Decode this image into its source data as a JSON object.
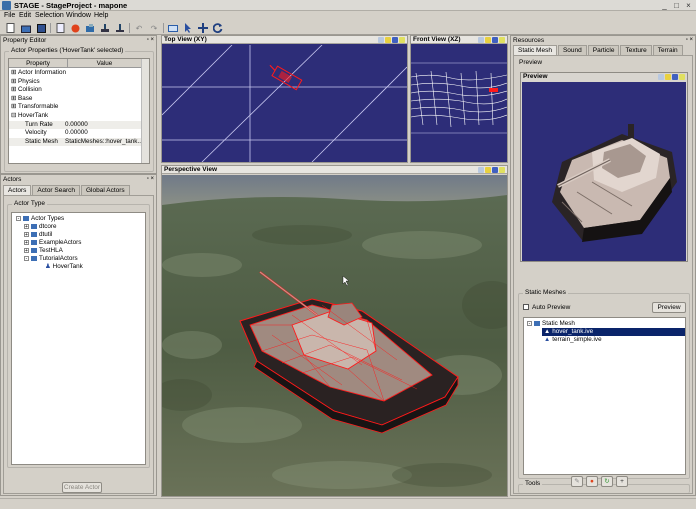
{
  "window": {
    "title": "STAGE - StageProject - mapone"
  },
  "menu": [
    "File",
    "Edit",
    "Selection",
    "Window",
    "Help"
  ],
  "property_editor": {
    "title": "Property Editor",
    "group_label": "Actor Properties ('HoverTank' selected)",
    "columns": [
      "Property",
      "Value"
    ],
    "rows": [
      {
        "name": "Actor Information",
        "value": "",
        "type": "group"
      },
      {
        "name": "Physics",
        "value": "",
        "type": "group"
      },
      {
        "name": "Collision",
        "value": "",
        "type": "group"
      },
      {
        "name": "Base",
        "value": "",
        "type": "group"
      },
      {
        "name": "Transformable",
        "value": "",
        "type": "group"
      },
      {
        "name": "HoverTank",
        "value": "",
        "type": "open"
      },
      {
        "name": "Turn Rate",
        "value": "0.00000",
        "type": "prop"
      },
      {
        "name": "Velocity",
        "value": "0.00000",
        "type": "prop"
      },
      {
        "name": "Static Mesh",
        "value": "StaticMeshes::hover_tank...",
        "type": "prop"
      }
    ]
  },
  "actors": {
    "title": "Actors",
    "tabs": [
      "Actors",
      "Actor Search",
      "Global Actors"
    ],
    "group_label": "Actor Type",
    "tree": {
      "root": "Actor Types",
      "children": [
        "dtcore",
        "dtutil",
        "ExampleActors",
        "TestHLA",
        "TutorialActors"
      ],
      "leaf": "HoverTank"
    },
    "create_button": "Create Actor"
  },
  "viewports": {
    "top": "Top View (XY)",
    "front": "Front View (XZ)",
    "perspective": "Perspective View"
  },
  "resources": {
    "title": "Resources",
    "tabs": [
      "Static Mesh",
      "Sound",
      "Particle",
      "Texture",
      "Terrain"
    ],
    "preview_group": "Preview",
    "preview_title": "Preview",
    "static_meshes_group": "Static Meshes",
    "auto_preview": "Auto Preview",
    "preview_button": "Preview",
    "tree": {
      "root": "Static Mesh",
      "items": [
        "hover_tank.ive",
        "terrain_simple.ive"
      ]
    },
    "tools_group": "Tools"
  },
  "colors": {
    "viewport_blue": "#2d2d78",
    "wire_red": "#ff1a1a",
    "selection": "#0a246a"
  }
}
